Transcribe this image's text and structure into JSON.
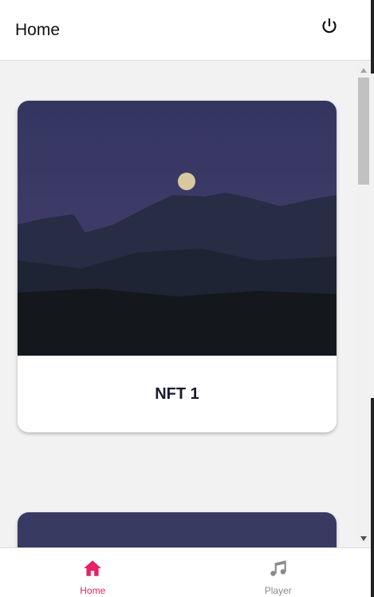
{
  "header": {
    "title": "Home",
    "power_icon": "power-icon"
  },
  "cards": [
    {
      "label": "NFT 1"
    },
    {
      "label": ""
    }
  ],
  "nav": {
    "items": [
      {
        "label": "Home",
        "icon": "home-icon",
        "active": true,
        "color": "#e91e63"
      },
      {
        "label": "Player",
        "icon": "music-note-icon",
        "active": false,
        "color": "#8a8a8a"
      }
    ]
  }
}
